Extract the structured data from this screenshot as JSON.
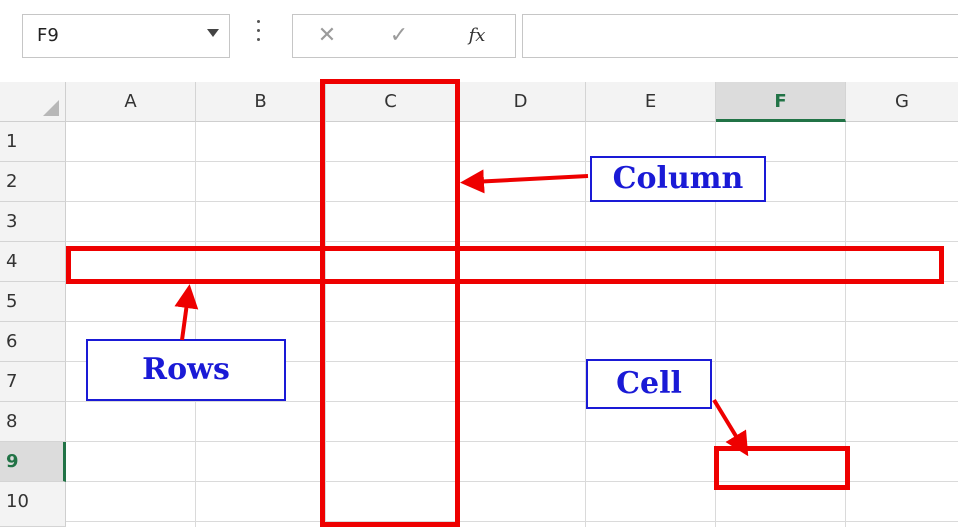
{
  "formula_bar": {
    "name_box_value": "F9",
    "cancel_glyph": "✕",
    "enter_glyph": "✓",
    "fx_label": "fx"
  },
  "columns": [
    "A",
    "B",
    "C",
    "D",
    "E",
    "F",
    "G"
  ],
  "rows": [
    "1",
    "2",
    "3",
    "4",
    "5",
    "6",
    "7",
    "8",
    "9",
    "10"
  ],
  "selected": {
    "column": "F",
    "row": "9"
  },
  "annotations": {
    "column_label": "Column",
    "rows_label": "Rows",
    "cell_label": "Cell"
  },
  "colors": {
    "highlight": "#ee0000",
    "label_text": "#1a1ad6",
    "selection_accent": "#217346"
  }
}
